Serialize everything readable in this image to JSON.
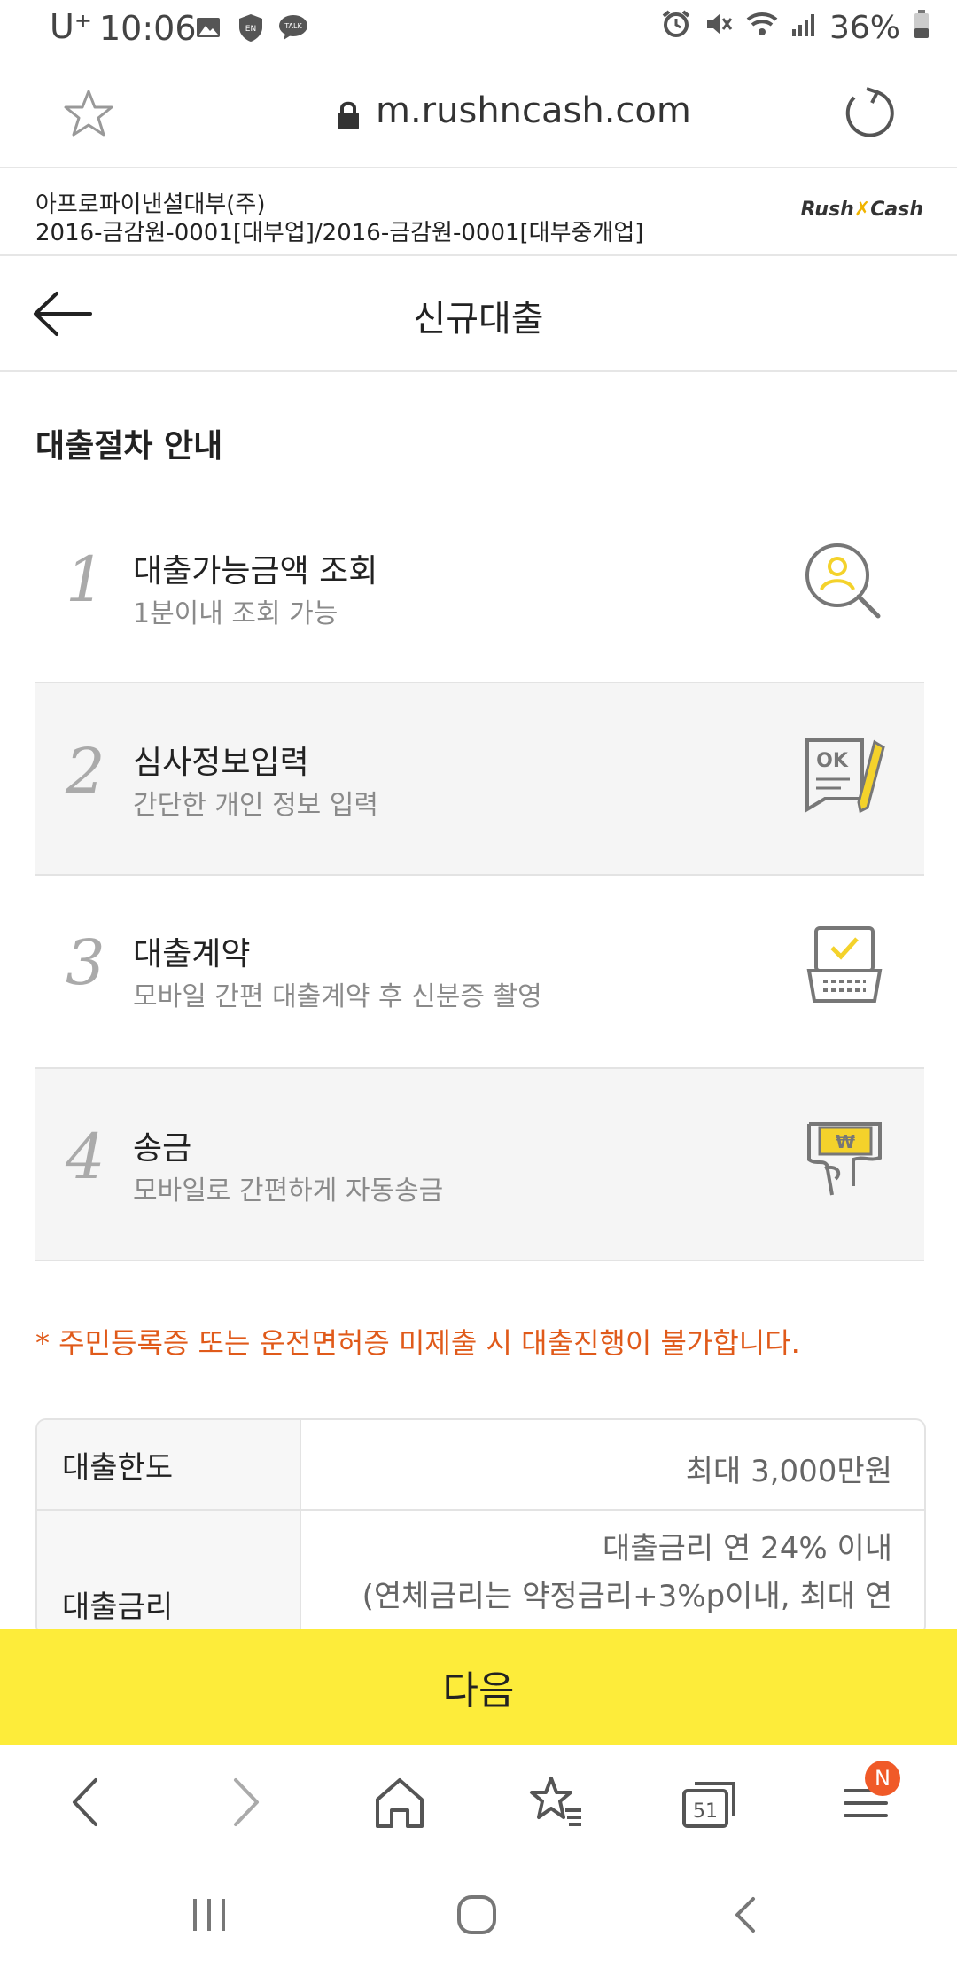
{
  "status_bar": {
    "carrier": "U⁺",
    "time": "10:06",
    "battery": "36%"
  },
  "browser": {
    "url": "m.rushncash.com",
    "tab_count": "51",
    "menu_badge": "N"
  },
  "company": {
    "name": "아프로파이낸셜대부(주)",
    "registration": "2016-금감원-0001[대부업]/2016-금감원-0001[대부중개업]",
    "logo_left": "Rush",
    "logo_mark": "✗",
    "logo_right": "Cash"
  },
  "page": {
    "title": "신규대출",
    "section_title": "대출절차 안내"
  },
  "steps": [
    {
      "number": "1",
      "title": "대출가능금액 조회",
      "desc": "1분이내 조회 가능",
      "icon": "person-search-icon"
    },
    {
      "number": "2",
      "title": "심사정보입력",
      "desc": "간단한 개인 정보 입력",
      "icon": "document-pencil-icon"
    },
    {
      "number": "3",
      "title": "대출계약",
      "desc": "모바일 간편 대출계약 후 신분증 촬영",
      "icon": "contract-check-icon"
    },
    {
      "number": "4",
      "title": "송금",
      "desc": "모바일로 간편하게 자동송금",
      "icon": "money-transfer-icon"
    }
  ],
  "notice": "* 주민등록증 또는 운전면허증 미제출 시 대출진행이 불가합니다.",
  "info_table": {
    "rows": [
      {
        "label": "대출한도",
        "value": "최대 3,000만원"
      },
      {
        "label": "대출금리",
        "value_line1": "대출금리 연 24% 이내",
        "value_line2": "(연체금리는 약정금리+3%p이내, 최대 연"
      }
    ]
  },
  "next_button": "다음",
  "colors": {
    "accent_yellow": "#fdec3a",
    "notice_orange": "#e05a1a",
    "icon_yellow": "#f4d22b"
  }
}
